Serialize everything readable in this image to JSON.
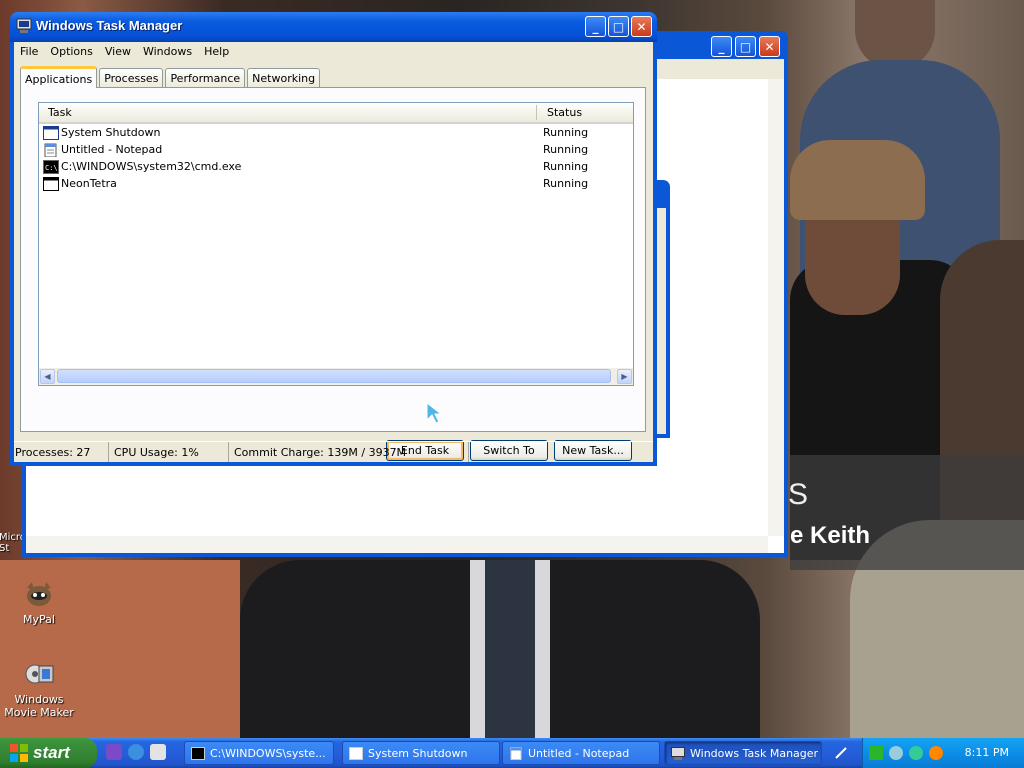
{
  "task_manager": {
    "title": "Windows Task Manager",
    "menu": [
      "File",
      "Options",
      "View",
      "Windows",
      "Help"
    ],
    "tabs": [
      "Applications",
      "Processes",
      "Performance",
      "Networking"
    ],
    "active_tab": "Applications",
    "columns": {
      "task": "Task",
      "status": "Status"
    },
    "rows": [
      {
        "task": "System Shutdown",
        "status": "Running",
        "icon": "window-icon"
      },
      {
        "task": "Untitled - Notepad",
        "status": "Running",
        "icon": "notepad-icon"
      },
      {
        "task": "C:\\WINDOWS\\system32\\cmd.exe",
        "status": "Running",
        "icon": "cmd-icon"
      },
      {
        "task": "NeonTetra",
        "status": "Running",
        "icon": "window-icon"
      }
    ],
    "buttons": {
      "end_task": "End Task",
      "switch_to": "Switch To",
      "new_task": "New Task..."
    },
    "status": {
      "processes": "Processes: 27",
      "cpu": "CPU Usage: 1%",
      "commit": "Commit Charge: 139M / 3937M"
    }
  },
  "desktop": {
    "icons": [
      {
        "label": "MyPal",
        "icon": "mypal-icon"
      },
      {
        "label": "Windows Movie Maker",
        "icon": "movie-maker-icon"
      }
    ],
    "partial_label": "Micro\nSt",
    "background_caption": {
      "fragment1": "S",
      "fragment2": "e Keith"
    }
  },
  "taskbar": {
    "start_label": "start",
    "buttons": [
      {
        "label": "C:\\WINDOWS\\syste...",
        "icon": "cmd-icon"
      },
      {
        "label": "System Shutdown",
        "icon": "window-icon"
      },
      {
        "label": "Untitled - Notepad",
        "icon": "notepad-icon"
      },
      {
        "label": "Windows Task Manager",
        "icon": "taskmanager-icon"
      }
    ],
    "clock": "8:11 PM"
  },
  "colors": {
    "xp_blue": "#0a57d8",
    "start_green": "#3a8f3a",
    "tray_blue": "#0c8ee6"
  }
}
